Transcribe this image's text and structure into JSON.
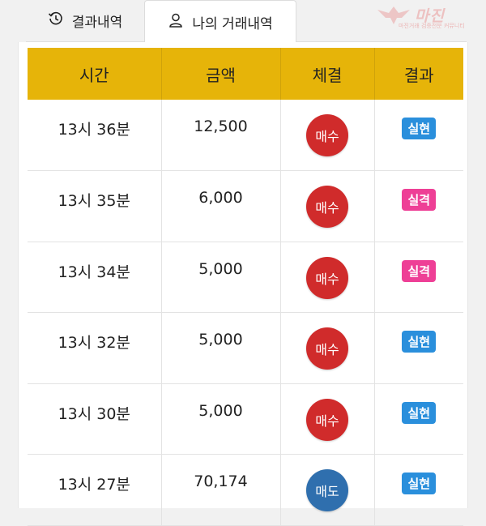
{
  "tabs": {
    "history_label": "결과내역",
    "my_trades_label": "나의 거래내역"
  },
  "logo": {
    "text": "마진",
    "subtext": "마진거래 검증전문 커뮤니티"
  },
  "table": {
    "headers": [
      "시간",
      "금액",
      "체결",
      "결과"
    ],
    "rows": [
      {
        "time": "13시 36분",
        "amount": "12,500",
        "side": "매수",
        "result": "실현"
      },
      {
        "time": "13시 35분",
        "amount": "6,000",
        "side": "매수",
        "result": "실격"
      },
      {
        "time": "13시 34분",
        "amount": "5,000",
        "side": "매수",
        "result": "실격"
      },
      {
        "time": "13시 32분",
        "amount": "5,000",
        "side": "매수",
        "result": "실현"
      },
      {
        "time": "13시 30분",
        "amount": "5,000",
        "side": "매수",
        "result": "실현"
      },
      {
        "time": "13시 27분",
        "amount": "70,174",
        "side": "매도",
        "result": "실현"
      }
    ]
  },
  "colors": {
    "header_bg": "#e6b409",
    "buy": "#d02b2b",
    "sell": "#2f6fae",
    "win": "#2a8fdc",
    "lose": "#ee3f96"
  }
}
